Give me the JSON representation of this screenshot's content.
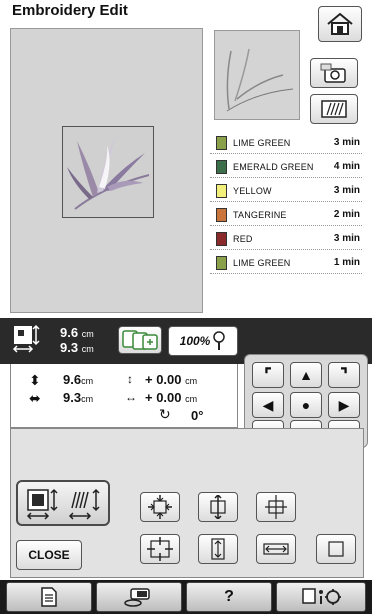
{
  "title": "Embroidery Edit",
  "colors": [
    {
      "name": "LIME GREEN",
      "time": "3 min",
      "hex": "#8aa04a"
    },
    {
      "name": "EMERALD GREEN",
      "time": "4 min",
      "hex": "#3c6e4a"
    },
    {
      "name": "YELLOW",
      "time": "3 min",
      "hex": "#f2ef7a"
    },
    {
      "name": "TANGERINE",
      "time": "2 min",
      "hex": "#c8743a"
    },
    {
      "name": "RED",
      "time": "3 min",
      "hex": "#8a2a2a"
    },
    {
      "name": "LIME GREEN",
      "time": "1 min",
      "hex": "#8aa04a"
    }
  ],
  "size": {
    "width": "9.6",
    "height": "9.3",
    "unit": "cm"
  },
  "zoom": "100%",
  "details": {
    "width": "9.6",
    "height": "9.3",
    "unit": "cm",
    "offset_v": "+ 0.00",
    "offset_h": "+ 0.00",
    "rotation": "0°"
  },
  "buttons": {
    "close": "CLOSE",
    "help": "?"
  }
}
